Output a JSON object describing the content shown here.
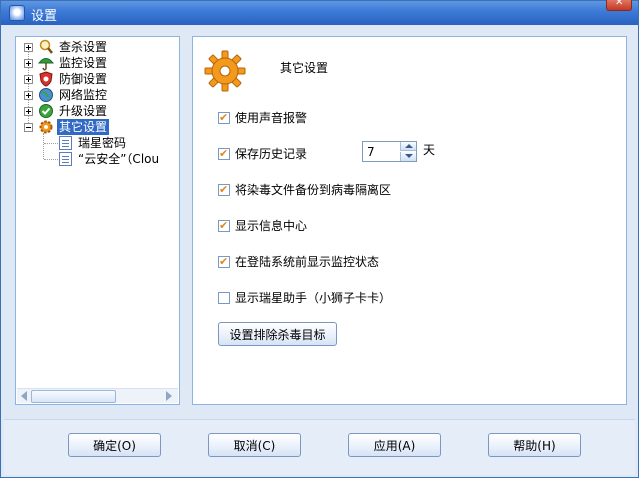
{
  "window": {
    "title": "设置"
  },
  "tree": {
    "items": [
      {
        "label": "查杀设置",
        "icon": "magnifier-icon"
      },
      {
        "label": "监控设置",
        "icon": "umbrella-icon"
      },
      {
        "label": "防御设置",
        "icon": "shield-icon"
      },
      {
        "label": "网络监控",
        "icon": "globe-icon"
      },
      {
        "label": "升级设置",
        "icon": "upgrade-check-icon"
      },
      {
        "label": "其它设置",
        "icon": "gear-icon",
        "selected": true
      }
    ],
    "children": [
      {
        "label": "瑞星密码"
      },
      {
        "label": "“云安全”（Clou"
      }
    ]
  },
  "content": {
    "heading": "其它设置",
    "options": [
      {
        "label": "使用声音报警",
        "checked": true
      },
      {
        "label": "保存历史记录",
        "checked": true
      },
      {
        "label": "将染毒文件备份到病毒隔离区",
        "checked": true
      },
      {
        "label": "显示信息中心",
        "checked": true
      },
      {
        "label": "在登陆系统前显示监控状态",
        "checked": true
      },
      {
        "label": "显示瑞星助手（小狮子卡卡）",
        "checked": false
      }
    ],
    "history_days": "7",
    "history_unit": "天",
    "exclude_button": "设置排除杀毒目标"
  },
  "buttons": {
    "ok": "确定(O)",
    "cancel": "取消(C)",
    "apply": "应用(A)",
    "help": "帮助(H)"
  }
}
